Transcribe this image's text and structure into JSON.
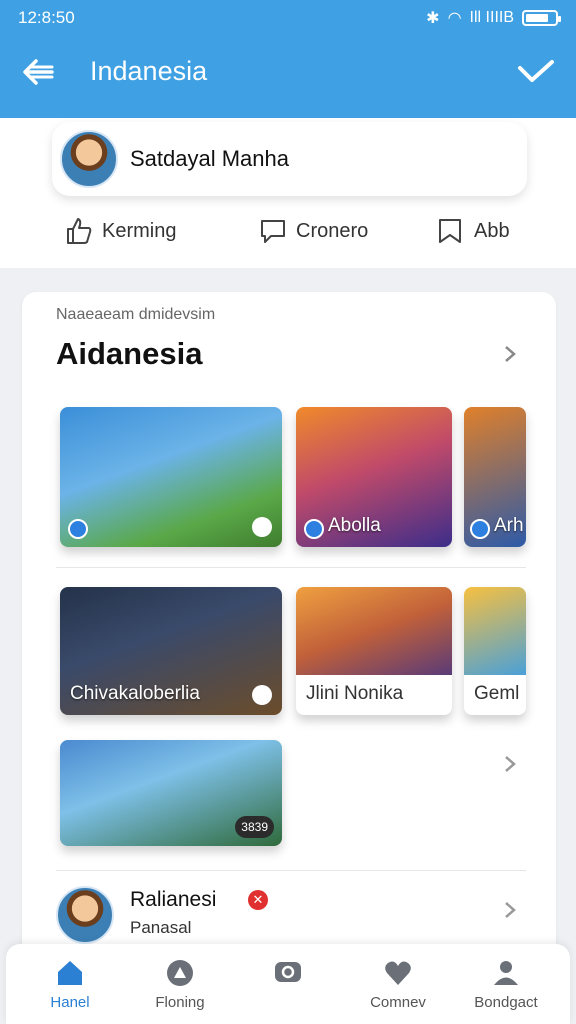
{
  "status": {
    "time": "12:8:50",
    "signal_text": "Ill IIIIB"
  },
  "appbar": {
    "title": "Indanesia"
  },
  "profile": {
    "name": "Satdayal Manha"
  },
  "actions": [
    {
      "label": "Kerming",
      "icon": "thumbs-up-icon"
    },
    {
      "label": "Cronero",
      "icon": "comment-icon"
    },
    {
      "label": "Abb",
      "icon": "bookmark-icon"
    }
  ],
  "section": {
    "subtitle": "Naaeaeam dmidevsim",
    "title": "Aidanesia"
  },
  "rows": [
    [
      {
        "label": "",
        "colors": [
          "#3b8fd8",
          "#5aa848"
        ]
      },
      {
        "label": "Abolla",
        "colors": [
          "#f08a2a",
          "#3c2d8a"
        ]
      },
      {
        "label": "Arh",
        "colors": [
          "#e0802a",
          "#2d5aa8"
        ]
      }
    ],
    [
      {
        "label": "Chivakaloberlia",
        "colors": [
          "#24324a",
          "#6b4c2a"
        ]
      },
      {
        "label": "Jlini Nonika",
        "colors": [
          "#f0a040",
          "#5a3b78"
        ]
      },
      {
        "label": "Geml",
        "colors": [
          "#f7c040",
          "#4aa0d8"
        ]
      }
    ],
    [
      {
        "label": "",
        "colors": [
          "#4a8ad0",
          "#2f6a3a"
        ],
        "pill": "3839"
      }
    ]
  ],
  "list_item": {
    "title": "Ralianesi",
    "subtitle": "Panasal"
  },
  "nav": [
    {
      "label": "Hanel",
      "icon": "home-icon",
      "active": true
    },
    {
      "label": "Floning",
      "icon": "flag-icon",
      "active": false
    },
    {
      "label": "",
      "icon": "chat-icon",
      "active": false
    },
    {
      "label": "Comnev",
      "icon": "heart-icon",
      "active": false
    },
    {
      "label": "Bondgact",
      "icon": "person-icon",
      "active": false
    }
  ],
  "colors": {
    "primary": "#3fa1e3",
    "accent_nav": "#2b80d4",
    "badge_red": "#e0302f"
  }
}
